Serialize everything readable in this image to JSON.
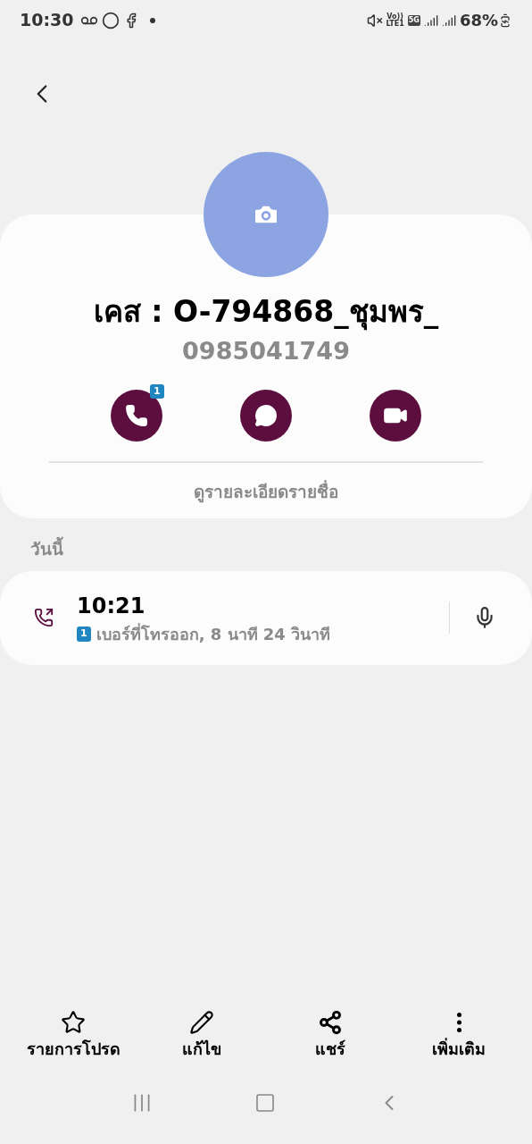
{
  "status_bar": {
    "time": "10:30",
    "network": [
      "Vo))",
      "LTE1",
      "5G"
    ],
    "battery": "68%"
  },
  "contact": {
    "name": "เคส : O-794868_ชุมพร_",
    "phone": "0985041749",
    "call_sim": "1",
    "details_link": "ดูรายละเอียดรายชื่อ"
  },
  "section_title": "วันนี้",
  "call_log": [
    {
      "time": "10:21",
      "sim": "1",
      "description": "เบอร์ที่โทรออก, 8 นาที 24 วินาที"
    }
  ],
  "bottom_actions": [
    {
      "kind": "star",
      "label": "รายการโปรด"
    },
    {
      "kind": "edit",
      "label": "แก้ไข"
    },
    {
      "kind": "share",
      "label": "แชร์"
    },
    {
      "kind": "more",
      "label": "เพิ่มเติม"
    }
  ]
}
